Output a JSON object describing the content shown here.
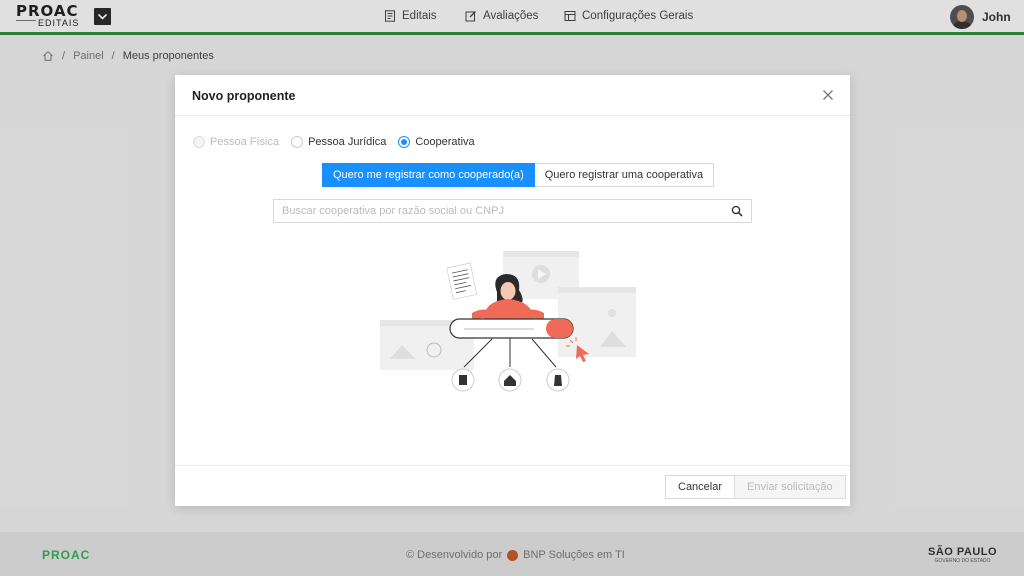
{
  "header": {
    "logo_top": "PROAC",
    "logo_bottom": "EDITAIS",
    "nav": [
      {
        "label": "Editais",
        "icon": "document-list-icon"
      },
      {
        "label": "Avaliações",
        "icon": "edit-icon"
      },
      {
        "label": "Configurações Gerais",
        "icon": "table-icon"
      }
    ],
    "user_name": "John"
  },
  "breadcrumb": {
    "items": [
      "Painel",
      "Meus proponentes"
    ]
  },
  "modal": {
    "title": "Novo proponente",
    "radios": [
      {
        "label": "Pessoa Física",
        "state": "disabled"
      },
      {
        "label": "Pessoa Jurídica",
        "state": "unchecked"
      },
      {
        "label": "Cooperativa",
        "state": "checked"
      }
    ],
    "segments": [
      {
        "label": "Quero me registrar como cooperado(a)",
        "active": true
      },
      {
        "label": "Quero registrar uma cooperativa",
        "active": false
      }
    ],
    "search_placeholder": "Buscar cooperativa por razão social ou CNPJ",
    "cancel_label": "Cancelar",
    "send_label": "Enviar solicitação"
  },
  "footer": {
    "logo": "PROAC",
    "developed_by": "© Desenvolvido por",
    "company": "BNP Soluções em TI",
    "state_logo_top": "SÃO PAULO",
    "state_logo_bottom": "GOVERNO DO ESTADO"
  },
  "colors": {
    "primary": "#1890ff",
    "header_border": "#2e8b3a",
    "illustration_accent": "#ef6a57"
  }
}
